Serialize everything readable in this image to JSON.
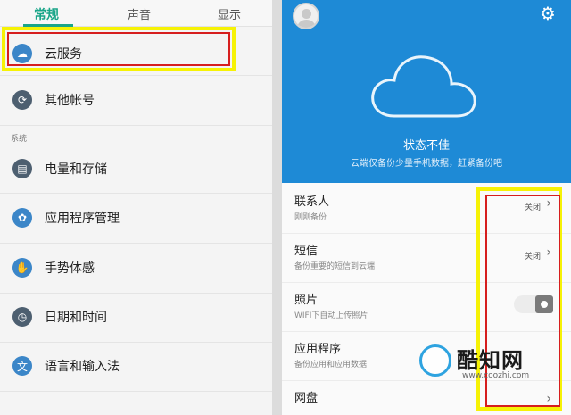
{
  "tabs": [
    "常规",
    "声音",
    "显示"
  ],
  "rows": [
    {
      "label": "云服务",
      "icon": "cloud-icon"
    },
    {
      "label": "其他帐号",
      "icon": "sync-icon"
    },
    {
      "label": "电量和存储",
      "icon": "battery-icon"
    },
    {
      "label": "应用程序管理",
      "icon": "apps-icon"
    },
    {
      "label": "手势体感",
      "icon": "gesture-icon"
    },
    {
      "label": "日期和时间",
      "icon": "clock-icon"
    },
    {
      "label": "语言和输入法",
      "icon": "language-icon"
    }
  ],
  "section": "系统",
  "header": {
    "status": "状态不佳",
    "subtitle": "云端仅备份少量手机数据，赶紧备份吧"
  },
  "items": [
    {
      "title": "联系人",
      "sub": "刚刚备份",
      "value": "关闭"
    },
    {
      "title": "短信",
      "sub": "备份重要的短信到云端",
      "value": "关闭"
    },
    {
      "title": "照片",
      "sub": "WIFI下自动上传照片",
      "value": ""
    },
    {
      "title": "应用程序",
      "sub": "备份应用和应用数据",
      "value": ""
    },
    {
      "title": "网盘",
      "sub": "",
      "value": ""
    }
  ],
  "watermark": {
    "name": "酷知网",
    "url": "www.coozhi.com"
  },
  "colors": {
    "accent": "#1aa589",
    "header": "#1e8ad6",
    "highlight_yellow": "#f6f205",
    "highlight_red": "#d61e1e"
  }
}
